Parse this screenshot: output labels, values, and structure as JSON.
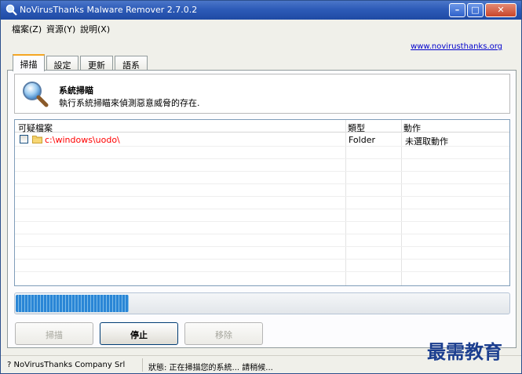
{
  "window": {
    "title": "NoVirusThanks Malware Remover 2.7.0.2",
    "controls": {
      "minimize": "–",
      "maximize": "□",
      "close": "✕"
    }
  },
  "menu": [
    {
      "label": "檔案(Z)"
    },
    {
      "label": "資源(Y)"
    },
    {
      "label": "說明(X)"
    }
  ],
  "site_link": "www.novirusthanks.org",
  "tabs": [
    {
      "label": "掃描",
      "active": true
    },
    {
      "label": "設定",
      "active": false
    },
    {
      "label": "更新",
      "active": false
    },
    {
      "label": "語系",
      "active": false
    }
  ],
  "header": {
    "title": "系統掃瞄",
    "description": "執行系統掃瞄來偵測惡意威脅的存在.",
    "icon": "magnifier-icon"
  },
  "list": {
    "columns": [
      "可疑檔案",
      "類型",
      "動作"
    ],
    "rows": [
      {
        "checked": false,
        "path": "c:\\windows\\uodo\\",
        "type": "Folder",
        "action": "未選取動作"
      }
    ]
  },
  "progress": {
    "percent": 23
  },
  "buttons": {
    "scan": "掃描",
    "stop": "停止",
    "remove": "移除"
  },
  "status": {
    "company": "? NoVirusThanks Company Srl",
    "message": "狀態: 正在掃描您的系統... 請稍候..."
  },
  "watermark": "最需教育",
  "colors": {
    "titlebar": "#2d5bb8",
    "path_text": "#ff0000",
    "progress": "#2a86d6",
    "link": "#0000cc"
  }
}
